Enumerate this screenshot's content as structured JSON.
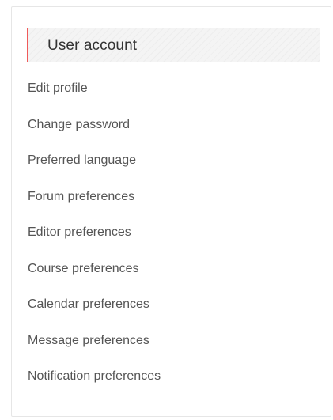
{
  "panel": {
    "title": "User account",
    "items": [
      {
        "label": "Edit profile"
      },
      {
        "label": "Change password"
      },
      {
        "label": "Preferred language"
      },
      {
        "label": "Forum preferences"
      },
      {
        "label": "Editor preferences"
      },
      {
        "label": "Course preferences"
      },
      {
        "label": "Calendar preferences"
      },
      {
        "label": "Message preferences"
      },
      {
        "label": "Notification preferences"
      }
    ]
  },
  "colors": {
    "accent": "#f05a5a",
    "header_bg": "#f4f4f4",
    "text": "#555555"
  }
}
